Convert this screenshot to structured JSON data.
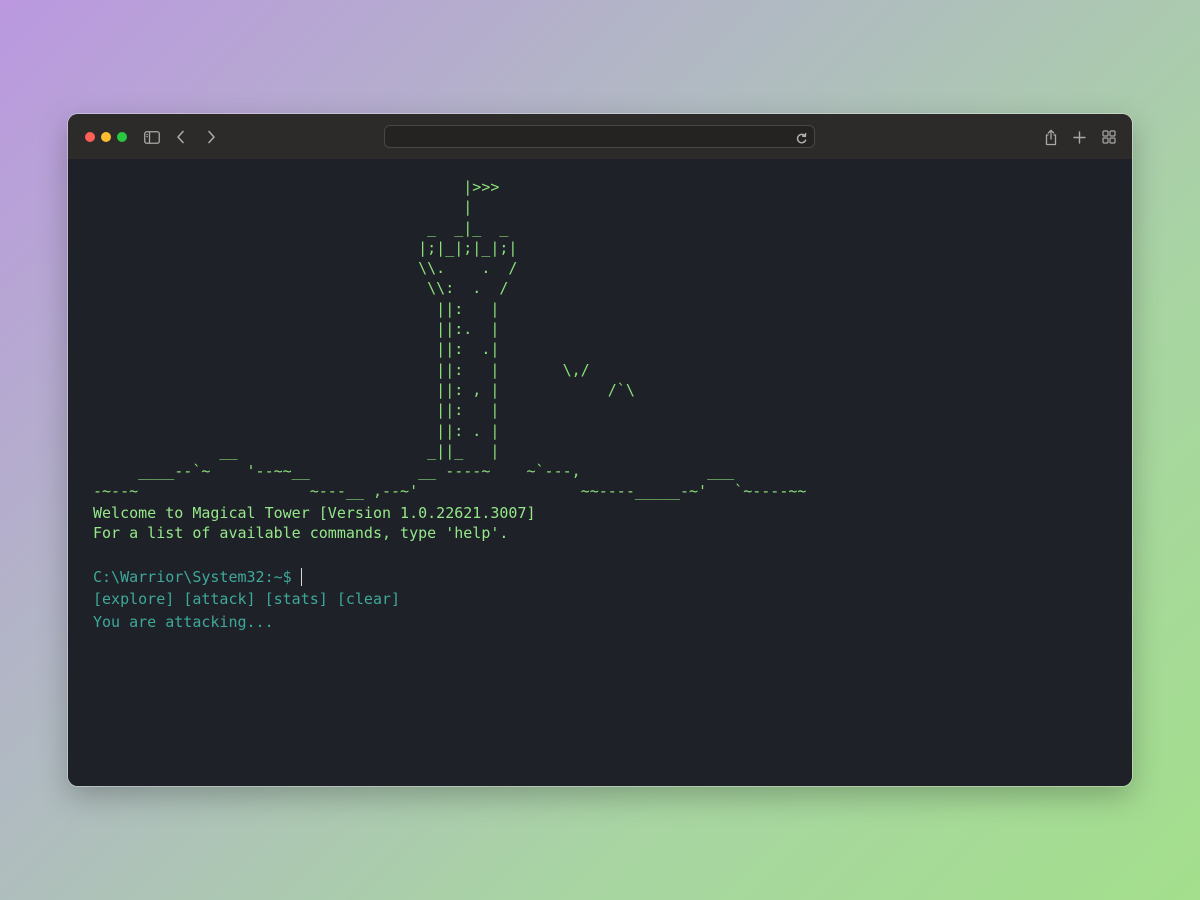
{
  "browser": {
    "address_value": "",
    "icons": [
      "sidebar-icon",
      "chevron-left-icon",
      "chevron-right-icon",
      "reload-icon",
      "share-icon",
      "plus-icon",
      "tab-overview-icon"
    ]
  },
  "terminal": {
    "ascii_art": "                                         |>>>\n                                         |\n                                     _  _|_  _\n                                    |;|_|;|_|;|\n                                    \\\\.    .  /\n                                     \\\\:  .  /\n                                      ||:   |\n                                      ||:.  |\n                                      ||:  .|\n                                      ||:   |       \\,/\n                                      ||: , |            /`\\\n                                      ||:   |\n                                      ||: . |\n              __                     _||_   |\n     ____--`~    '--~~__            __ ----~    ~`---,              ___\n-~--~                   ~---__ ,--~'                  ~~----_____-~'   `~----~~",
    "welcome": "Welcome to Magical Tower [Version 1.0.22621.3007]",
    "help_hint": "For a list of available commands, type 'help'.",
    "prompt": "C:\\Warrior\\System32:~$",
    "commands": [
      "[explore]",
      "[attack]",
      "[stats]",
      "[clear]"
    ],
    "output": "You are attacking..."
  },
  "colors": {
    "ascii_green": "#8ce07a",
    "prompt_teal": "#3fa89a",
    "terminal_bg": "#1e2127",
    "toolbar_bg": "#2c2b2a"
  }
}
